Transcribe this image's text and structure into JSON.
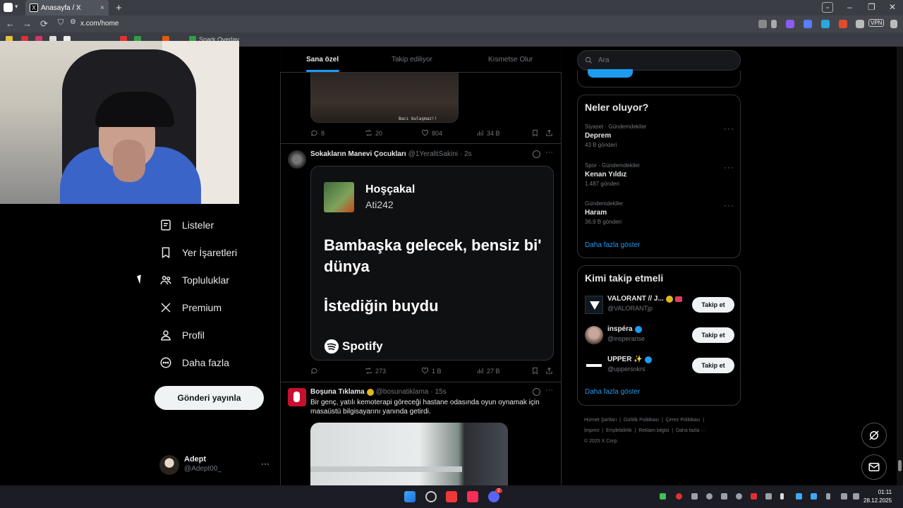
{
  "browser": {
    "tab_title": "Anasayfa / X",
    "tab_favicon": "X",
    "url": "x.com/home",
    "bookmark_label": "Spark Overlay",
    "vpn_label": "VPN"
  },
  "nav": {
    "items": [
      {
        "label": "Listeler",
        "icon": "list-icon"
      },
      {
        "label": "Yer İşaretleri",
        "icon": "bookmark-icon"
      },
      {
        "label": "Topluluklar",
        "icon": "communities-icon"
      },
      {
        "label": "Premium",
        "icon": "x-logo-icon"
      },
      {
        "label": "Profil",
        "icon": "profile-icon"
      },
      {
        "label": "Daha fazla",
        "icon": "more-circle-icon"
      }
    ],
    "post_button": "Gönderi yayınla",
    "account": {
      "name": "Adept",
      "handle": "@Adept00_",
      "more": "···"
    }
  },
  "feed": {
    "tabs": [
      "Sana özel",
      "Takip ediliyor",
      "Kısmetse Olur"
    ],
    "active_tab": "Sana özel",
    "prev_post": {
      "image_caption": "Bacı bulaşmaz!!",
      "replies": "8",
      "reposts": "20",
      "likes": "804",
      "views": "34 B"
    },
    "post1": {
      "author": "Sokakların Manevi Çocukları",
      "handle": "@1YeraltiSakini",
      "time": "· 2s",
      "card": {
        "title": "Hoşçakal",
        "artist": "Ati242",
        "lyric1": "Bambaşka gelecek, bensiz bi' dünya",
        "lyric2": "İstediğin buydu",
        "brand": "Spotify"
      },
      "replies": "",
      "reposts": "273",
      "likes": "1 B",
      "views": "27 B"
    },
    "post2": {
      "author": "Boşuna Tıklama",
      "handle": "@bosunatiklama",
      "time": "· 15s",
      "text": "Bir genç, yatılı kemoterapi göreceği hastane odasında oyun oynamak için masaüstü bilgisayarını yanında getirdi."
    }
  },
  "sidebar": {
    "search_placeholder": "Ara",
    "trends_title": "Neler oluyor?",
    "trends": [
      {
        "category": "Siyaset · Gündemdekiler",
        "title": "Deprem",
        "count": "43 B gönderi"
      },
      {
        "category": "Spor · Gündemdekiler",
        "title": "Kenan Yıldız",
        "count": "1.487 gönderi"
      },
      {
        "category": "Gündemdekiler",
        "title": "Haram",
        "count": "36,9 B gönderi"
      }
    ],
    "trends_more": "Daha fazla göster",
    "follow_title": "Kimi takip etmeli",
    "follow": [
      {
        "name": "VALORANT // J...",
        "handle": "@VALORANTjp",
        "button": "Takip et"
      },
      {
        "name": "inspéra",
        "handle": "@insperarise",
        "button": "Takip et"
      },
      {
        "name": "UPPER ✨",
        "handle": "@uppersnkrs",
        "button": "Takip et"
      }
    ],
    "follow_more": "Daha fazla göster",
    "footer": {
      "links1": [
        "Hizmet Şartları",
        "Gizlilik Politikası",
        "Çerez Politikası"
      ],
      "links2": [
        "İmprint",
        "Erişilebilirlik",
        "Reklam bilgisi",
        "Daha fazla ···"
      ],
      "copyright": "© 2025 X Corp."
    }
  },
  "taskbar": {
    "time": "01:11",
    "date": "28.12.2025",
    "discord_badge": "2"
  },
  "colors": {
    "accent": "#1d9bf0",
    "verified_gold": "#e2b719",
    "border": "#2f3336"
  }
}
